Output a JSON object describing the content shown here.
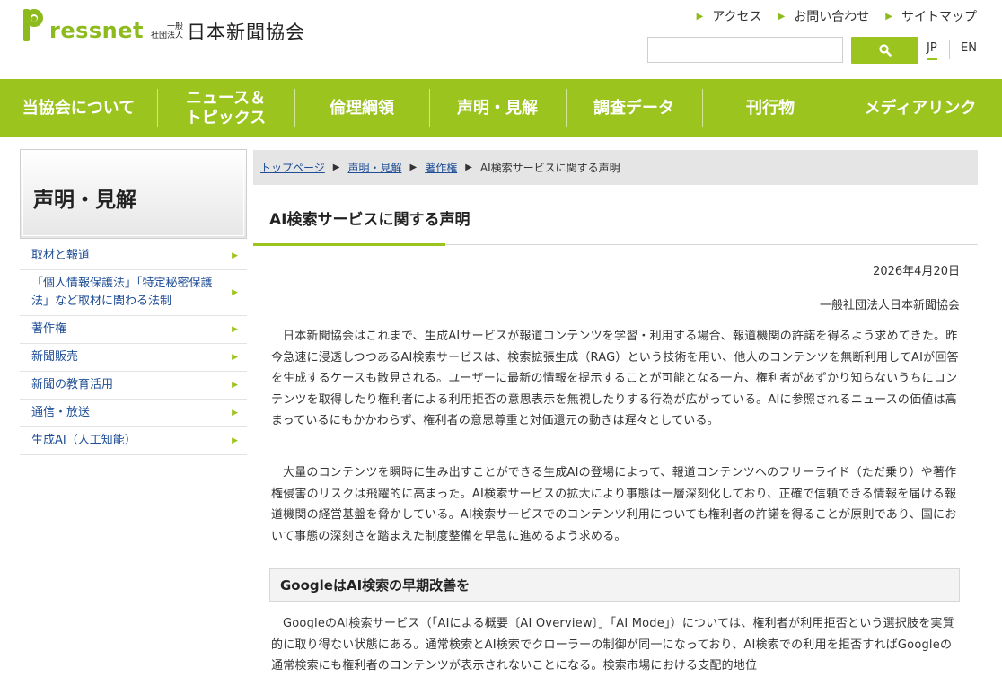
{
  "brand": {
    "logo_word": "ressnet",
    "org_small_1": "一般",
    "org_small_2": "社団法人",
    "org_name": "日本新聞協会"
  },
  "utility_links": [
    {
      "label": "アクセス"
    },
    {
      "label": "お問い合わせ"
    },
    {
      "label": "サイトマップ"
    }
  ],
  "search": {
    "value": "",
    "placeholder": ""
  },
  "lang": {
    "jp": "JP",
    "en": "EN",
    "active": "JP"
  },
  "nav": [
    {
      "label": "当協会について"
    },
    {
      "label": "ニュース＆\nトピックス"
    },
    {
      "label": "倫理綱領"
    },
    {
      "label": "声明・見解"
    },
    {
      "label": "調査データ"
    },
    {
      "label": "刊行物"
    },
    {
      "label": "メディアリンク"
    }
  ],
  "sidebar": {
    "title": "声明・見解",
    "items": [
      {
        "label": "取材と報道"
      },
      {
        "label": "「個人情報保護法」「特定秘密保護法」など取材に関わる法制"
      },
      {
        "label": "著作権"
      },
      {
        "label": "新聞販売"
      },
      {
        "label": "新聞の教育活用"
      },
      {
        "label": "通信・放送"
      },
      {
        "label": "生成AI（人工知能）"
      }
    ]
  },
  "breadcrumb": {
    "items": [
      "トップページ",
      "声明・見解",
      "著作権"
    ],
    "current": "AI検索サービスに関する声明"
  },
  "article": {
    "title": "AI検索サービスに関する声明",
    "date": "2026年4月20日",
    "author": "一般社団法人日本新聞協会",
    "paragraphs": [
      "日本新聞協会はこれまで、生成AIサービスが報道コンテンツを学習・利用する場合、報道機関の許諾を得るよう求めてきた。昨今急速に浸透しつつあるAI検索サービスは、検索拡張生成（RAG）という技術を用い、他人のコンテンツを無断利用してAIが回答を生成するケースも散見される。ユーザーに最新の情報を提示することが可能となる一方、権利者があずかり知らないうちにコンテンツを取得したり権利者による利用拒否の意思表示を無視したりする行為が広がっている。AIに参照されるニュースの価値は高まっているにもかかわらず、権利者の意思尊重と対価還元の動きは遅々としている。",
      "大量のコンテンツを瞬時に生み出すことができる生成AIの登場によって、報道コンテンツへのフリーライド（ただ乗り）や著作権侵害のリスクは飛躍的に高まった。AI検索サービスの拡大により事態は一層深刻化しており、正確で信頼できる情報を届ける報道機関の経営基盤を脅かしている。AI検索サービスでのコンテンツ利用についても権利者の許諾を得ることが原則であり、国において事態の深刻さを踏まえた制度整備を早急に進めるよう求める。",
      "GoogleのAI検索サービス（「AIによる概要〔AI Overview〕」「AI Mode」）については、権利者が利用拒否という選択肢を実質的に取り得ない状態にある。通常検索とAI検索でクローラーの制御が同一になっており、AI検索での利用を拒否すればGoogleの通常検索にも権利者のコンテンツが表示されないことになる。検索市場における支配的地位"
    ],
    "section_heading": "GoogleはAI検索の早期改善を"
  },
  "colors": {
    "brand_green": "#9cc41e",
    "link_blue": "#1f4e96"
  }
}
